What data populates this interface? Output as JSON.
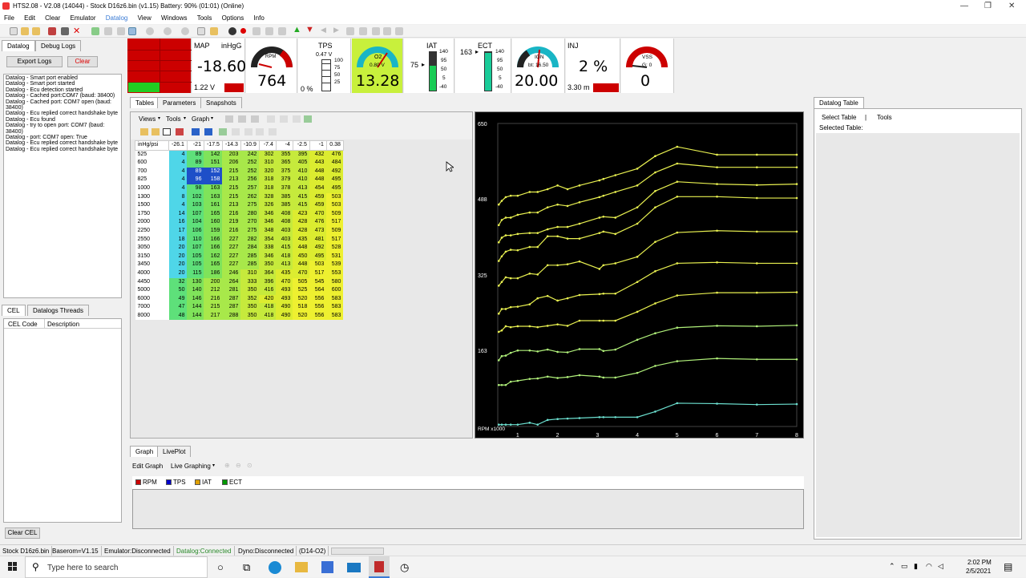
{
  "window": {
    "title": "HTS2.08 - V2.08 (14044) - Stock D16z6.bin (v1.15) Battery: 90% (01:01) (Online)"
  },
  "menu": [
    "File",
    "Edit",
    "Clear",
    "Emulator",
    "Datalog",
    "View",
    "Windows",
    "Tools",
    "Options",
    "Info"
  ],
  "left": {
    "tabs": [
      "Datalog",
      "Debug Logs"
    ],
    "export_label": "Export Logs",
    "clear_label": "Clear",
    "log_lines": [
      "Datalog - Smart port enabled",
      "Datalog - Smart port started",
      "Datalog - Ecu detection started",
      "Datalog - Cached port:COM7 (baud: 38400)",
      "Datalog - Cached port: COM7 open (baud: 38400)",
      "Datalog - Ecu replied correct handshake byte",
      "Datalog - Ecu found",
      "Datalog - try to open port: COM7 (baud: 38400)",
      "Datalog - port: COM7 open: True",
      "Datalog - Ecu replied correct handshake byte",
      "Datalog - Ecu replied correct handshake byte"
    ],
    "cel_tabs": [
      "CEL",
      "Datalogs Threads"
    ],
    "cel_headers": [
      "CEL Code",
      "Description"
    ],
    "clear_cel": "Clear CEL"
  },
  "gauges": {
    "map": {
      "label": "MAP",
      "unit": "inHgG",
      "value": "-18.60",
      "volt": "1.22 V"
    },
    "rpm": {
      "label": "RPM",
      "value": "764"
    },
    "tps": {
      "label": "TPS",
      "volt": "0.47 V",
      "pct": "0 %",
      "scale": [
        "100",
        "75",
        "50",
        "25"
      ]
    },
    "o2": {
      "label": "O2",
      "volt": "0.80 V",
      "value": "13.28"
    },
    "iat": {
      "label": "IAT",
      "val": "75",
      "scale": [
        "140",
        "95",
        "50",
        "5",
        "-40"
      ]
    },
    "ect": {
      "label": "ECT",
      "val": "163",
      "scale": [
        "140",
        "95",
        "50",
        "5",
        "-40"
      ]
    },
    "ign": {
      "label": "IGN",
      "sub": "bt: 16.50",
      "value": "20.00"
    },
    "inj": {
      "label": "INJ",
      "value": "2 %",
      "ms": "3.30 m"
    },
    "vss": {
      "label": "VSS",
      "sub": "G: 0",
      "value": "0"
    }
  },
  "main": {
    "tabs": [
      "Tables",
      "Parameters",
      "Snapshots"
    ],
    "sub_menu": [
      "Views",
      "Tools",
      "Graph"
    ],
    "table": {
      "corner": "inHg/psi",
      "cols": [
        "-26.1",
        "-21",
        "-17.5",
        "-14.3",
        "-10.9",
        "-7.4",
        "-4",
        "-2.5",
        "-1",
        "0.38"
      ],
      "rows": [
        [
          "525",
          "4",
          "89",
          "142",
          "203",
          "242",
          "302",
          "355",
          "395",
          "432",
          "476"
        ],
        [
          "600",
          "4",
          "89",
          "151",
          "206",
          "252",
          "310",
          "365",
          "405",
          "443",
          "484"
        ],
        [
          "700",
          "4",
          "89",
          "152",
          "215",
          "252",
          "320",
          "375",
          "410",
          "448",
          "492"
        ],
        [
          "825",
          "4",
          "96",
          "158",
          "213",
          "256",
          "318",
          "379",
          "410",
          "448",
          "495"
        ],
        [
          "1000",
          "4",
          "98",
          "163",
          "215",
          "257",
          "318",
          "378",
          "413",
          "454",
          "495"
        ],
        [
          "1300",
          "8",
          "102",
          "163",
          "215",
          "262",
          "328",
          "385",
          "415",
          "459",
          "503"
        ],
        [
          "1500",
          "4",
          "103",
          "161",
          "213",
          "275",
          "326",
          "385",
          "415",
          "459",
          "503"
        ],
        [
          "1750",
          "14",
          "107",
          "165",
          "216",
          "280",
          "346",
          "408",
          "423",
          "470",
          "509"
        ],
        [
          "2000",
          "16",
          "104",
          "160",
          "219",
          "270",
          "346",
          "408",
          "428",
          "476",
          "517"
        ],
        [
          "2250",
          "17",
          "106",
          "159",
          "216",
          "275",
          "348",
          "403",
          "428",
          "473",
          "509"
        ],
        [
          "2550",
          "18",
          "110",
          "166",
          "227",
          "282",
          "354",
          "403",
          "435",
          "481",
          "517"
        ],
        [
          "3050",
          "20",
          "107",
          "166",
          "227",
          "284",
          "338",
          "415",
          "448",
          "492",
          "528"
        ],
        [
          "3150",
          "20",
          "105",
          "162",
          "227",
          "285",
          "346",
          "418",
          "450",
          "495",
          "531"
        ],
        [
          "3450",
          "20",
          "105",
          "165",
          "227",
          "285",
          "350",
          "413",
          "448",
          "503",
          "539"
        ],
        [
          "4000",
          "20",
          "115",
          "186",
          "246",
          "310",
          "364",
          "435",
          "470",
          "517",
          "553"
        ],
        [
          "4450",
          "32",
          "130",
          "200",
          "264",
          "333",
          "396",
          "470",
          "505",
          "545",
          "580"
        ],
        [
          "5000",
          "50",
          "140",
          "212",
          "281",
          "350",
          "416",
          "493",
          "525",
          "564",
          "600"
        ],
        [
          "6000",
          "49",
          "146",
          "216",
          "287",
          "352",
          "420",
          "493",
          "520",
          "556",
          "583"
        ],
        [
          "7000",
          "47",
          "144",
          "215",
          "287",
          "350",
          "418",
          "490",
          "518",
          "556",
          "583"
        ],
        [
          "8000",
          "48",
          "144",
          "217",
          "288",
          "350",
          "418",
          "490",
          "520",
          "556",
          "583"
        ]
      ]
    }
  },
  "chart_data": {
    "type": "line",
    "xlabel": "RPM x1000",
    "x_ticks": [
      "1",
      "2",
      "3",
      "4",
      "5",
      "6",
      "7",
      "8"
    ],
    "y_ticks": [
      "650",
      "488",
      "325",
      "163"
    ],
    "ylim": [
      0,
      650
    ],
    "xlim": [
      0.5,
      8
    ]
  },
  "graph": {
    "tabs": [
      "Graph",
      "LivePlot"
    ],
    "edit": "Edit Graph",
    "live": "Live Graphing",
    "legend": [
      {
        "name": "RPM",
        "color": "#cc0000"
      },
      {
        "name": "TPS",
        "color": "#0000cc"
      },
      {
        "name": "IAT",
        "color": "#e0a000"
      },
      {
        "name": "ECT",
        "color": "#009900"
      }
    ]
  },
  "right": {
    "tab": "Datalog Table",
    "select": "Select Table",
    "sep": "|",
    "tools": "Tools",
    "selected": "Selected Table:"
  },
  "status": [
    "Stock D16z6.bin",
    "Baserom=V1.15",
    "Emulator:Disconnected",
    "Datalog:Connected",
    "Dyno:Disconnected",
    "(D14-O2)"
  ],
  "taskbar": {
    "search": "Type here to search",
    "time": "2:02 PM",
    "date": "2/5/2021"
  }
}
